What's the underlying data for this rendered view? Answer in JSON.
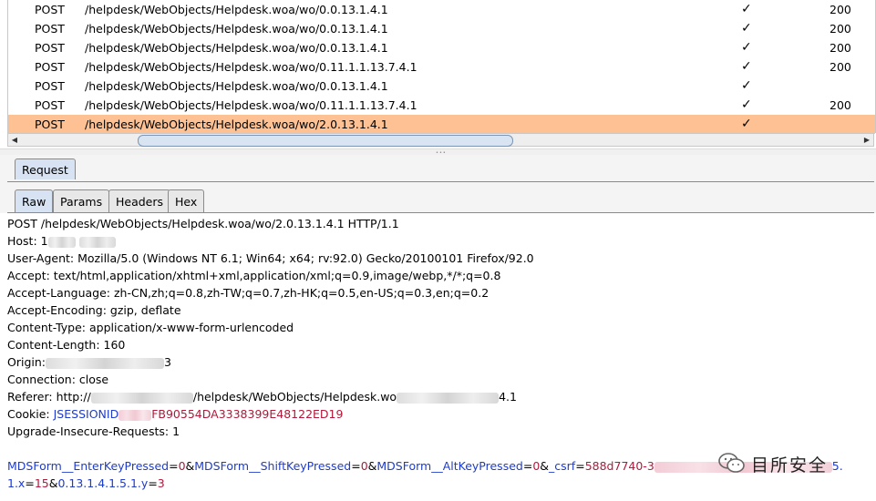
{
  "history": {
    "rows": [
      {
        "method": "POST",
        "url": "/helpdesk/WebObjects/Helpdesk.woa/wo/0.0.13.1.4.1",
        "check": "✓",
        "status": "200",
        "selected": false
      },
      {
        "method": "POST",
        "url": "/helpdesk/WebObjects/Helpdesk.woa/wo/0.0.13.1.4.1",
        "check": "✓",
        "status": "200",
        "selected": false
      },
      {
        "method": "POST",
        "url": "/helpdesk/WebObjects/Helpdesk.woa/wo/0.0.13.1.4.1",
        "check": "✓",
        "status": "200",
        "selected": false
      },
      {
        "method": "POST",
        "url": "/helpdesk/WebObjects/Helpdesk.woa/wo/0.11.1.1.13.7.4.1",
        "check": "✓",
        "status": "200",
        "selected": false
      },
      {
        "method": "POST",
        "url": "/helpdesk/WebObjects/Helpdesk.woa/wo/0.0.13.1.4.1",
        "check": "✓",
        "status": "",
        "selected": false
      },
      {
        "method": "POST",
        "url": "/helpdesk/WebObjects/Helpdesk.woa/wo/0.11.1.1.13.7.4.1",
        "check": "✓",
        "status": "200",
        "selected": false
      },
      {
        "method": "POST",
        "url": "/helpdesk/WebObjects/Helpdesk.woa/wo/2.0.13.1.4.1",
        "check": "✓",
        "status": "",
        "selected": true
      }
    ],
    "scroll_left_icon": "left-arrow-icon",
    "scroll_right_icon": "right-arrow-icon"
  },
  "request_tab": {
    "label": "Request"
  },
  "sub_tabs": [
    {
      "label": "Raw",
      "active": true
    },
    {
      "label": "Params",
      "active": false
    },
    {
      "label": "Headers",
      "active": false
    },
    {
      "label": "Hex",
      "active": false
    }
  ],
  "request": {
    "request_line": "POST /helpdesk/WebObjects/Helpdesk.woa/wo/2.0.13.1.4.1 HTTP/1.1",
    "host_label": "Host: 1",
    "user_agent": "User-Agent: Mozilla/5.0 (Windows NT 6.1; Win64; x64; rv:92.0) Gecko/20100101 Firefox/92.0",
    "accept": "Accept: text/html,application/xhtml+xml,application/xml;q=0.9,image/webp,*/*;q=0.8",
    "accept_language": "Accept-Language: zh-CN,zh;q=0.8,zh-TW;q=0.7,zh-HK;q=0.5,en-US;q=0.3,en;q=0.2",
    "accept_encoding": "Accept-Encoding: gzip, deflate",
    "content_type": "Content-Type: application/x-www-form-urlencoded",
    "content_length": "Content-Length: 160",
    "origin_label": "Origin:",
    "origin_tail": "3",
    "connection": "Connection: close",
    "referer_label": "Referer: http://",
    "referer_mid": "/helpdesk/WebObjects/Helpdesk.wo",
    "referer_tail": "4.1",
    "cookie_label": "Cookie: ",
    "cookie_name": "JSESSIONID",
    "cookie_value": "FB90554DA3338399E48122ED19",
    "upgrade": "Upgrade-Insecure-Requests: 1",
    "body_p1_key": "MDSForm__EnterKeyPressed",
    "body_p1_val": "0",
    "body_p2_key": "MDSForm__ShiftKeyPressed",
    "body_p2_val": "0",
    "body_p3_key": "MDSForm__AltKeyPressed",
    "body_p3_val": "0",
    "body_p4_key": "_csrf",
    "body_p4_val": "588d7740-3",
    "body_p4_tail": "5.",
    "body_line2_a": "1.x",
    "body_line2_a_val": "15",
    "body_line2_b": "0.13.1.4.1.5.1.y",
    "body_line2_b_val": "3"
  },
  "watermark": {
    "text": "目所安全"
  }
}
